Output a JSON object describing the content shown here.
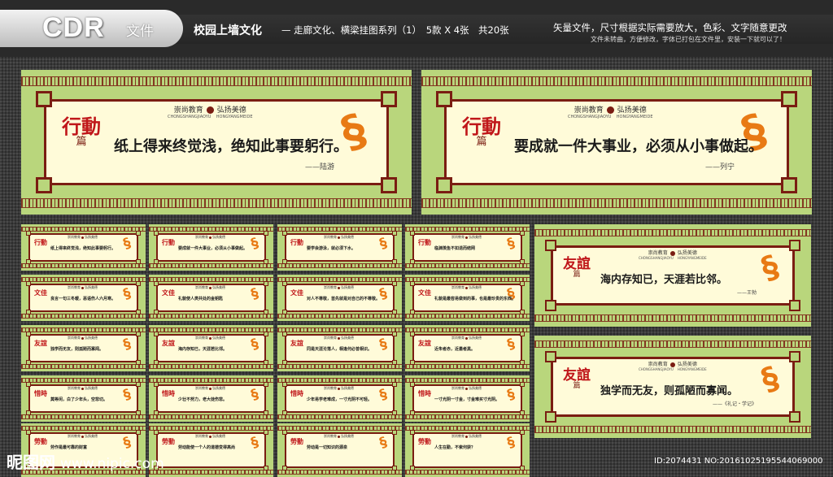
{
  "header": {
    "brand_big": "CDR",
    "brand_small": "文件",
    "title": "校园上墙文化",
    "subtitle": "— 走廊文化、横梁挂图系列（1）　5款 X 4张　共20张",
    "right_line1": "矢量文件，尺寸根据实际需要放大，色彩、文字随意更改",
    "right_line2": "文件未转曲，方便修改，字体已打包在文件里，安装一下就可以了！"
  },
  "motto": {
    "left": "崇尚教育",
    "right": "弘扬美德",
    "py_left": "CHONGSHANGJIAOYU",
    "py_right": "HONGYANGMEIDE"
  },
  "large_panels": [
    {
      "seal": "行動",
      "pian": "篇",
      "quote": "纸上得来终觉浅，绝知此事要躬行。",
      "author": "——陆游"
    },
    {
      "seal": "行動",
      "pian": "篇",
      "quote": "要成就一件大事业，必须从小事做起。",
      "author": "——列宁"
    },
    {
      "seal": "友誼",
      "pian": "篇",
      "quote": "海内存知已，天涯若比邻。",
      "author": "——王勃"
    },
    {
      "seal": "友誼",
      "pian": "篇",
      "quote": "独学而无友，则孤陋而寡闻。",
      "author": "——《礼记・学记》"
    }
  ],
  "small_panels": [
    {
      "seal": "行動",
      "quote": "纸上得来终觉浅，绝知此事要躬行。"
    },
    {
      "seal": "行動",
      "quote": "要成就一件大事业，必须从小事做起。"
    },
    {
      "seal": "行動",
      "quote": "要学会游泳，就必须下水。"
    },
    {
      "seal": "行動",
      "quote": "临渊羡鱼不如退而结网"
    },
    {
      "seal": "文佳",
      "quote": "良言一句三冬暖，恶语伤人六月寒。"
    },
    {
      "seal": "文佳",
      "quote": "礼貌使人类共处的金钥匙"
    },
    {
      "seal": "文佳",
      "quote": "对人不尊敬，首先就是对自己的不尊敬。"
    },
    {
      "seal": "文佳",
      "quote": "礼貌是最容易做到的事，也是最珍贵的东西。"
    },
    {
      "seal": "友誼",
      "quote": "独学而无友，则孤陋而寡闻。"
    },
    {
      "seal": "友誼",
      "quote": "海内存知已，天涯若比邻。"
    },
    {
      "seal": "友誼",
      "quote": "同是天涯沦落人，相逢何必曾相识。"
    },
    {
      "seal": "友誼",
      "quote": "近朱者赤，近墨者黑。"
    },
    {
      "seal": "惜時",
      "quote": "莫等闲，白了少年头，空悲切。"
    },
    {
      "seal": "惜時",
      "quote": "少壮不努力，老大徒伤悲。"
    },
    {
      "seal": "惜時",
      "quote": "少年易学老难成，一寸光阴不可轻。"
    },
    {
      "seal": "惜時",
      "quote": "一寸光阴一寸金，寸金难买寸光阴。"
    },
    {
      "seal": "勞動",
      "quote": "劳作是最可靠的财富"
    },
    {
      "seal": "勞動",
      "quote": "劳动能使一个人的道德变得高尚"
    },
    {
      "seal": "勞動",
      "quote": "劳动是一切知识的源泉"
    },
    {
      "seal": "勞動",
      "quote": "人生在勤，不索何获？"
    }
  ],
  "watermark": {
    "logo": "昵图网",
    "url": "www.nipic.com"
  },
  "id_text": "ID:2074431 NO:20161025195544069000",
  "colors": {
    "panel_green": "#b9d67c",
    "frame_red": "#7a1d12",
    "seal_red": "#c0171a",
    "cloud_orange": "#e87a14"
  }
}
